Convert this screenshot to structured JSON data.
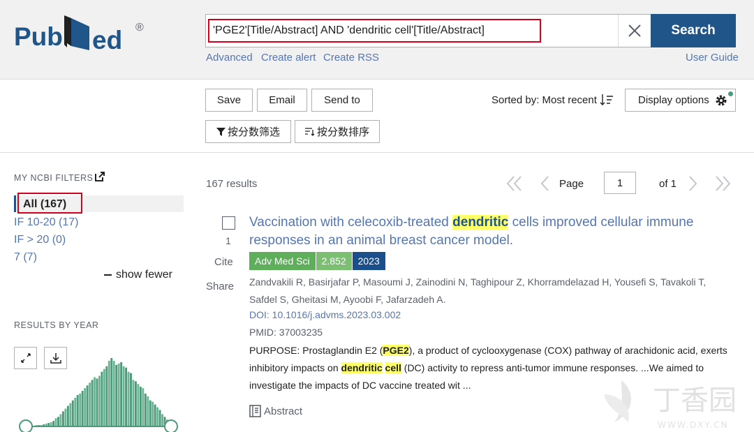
{
  "header": {
    "logo_text_left": "Pub",
    "logo_text_right": "ed",
    "logo_reg": "®",
    "search_value": "'PGE2'[Title/Abstract] AND 'dendritic cell'[Title/Abstract]",
    "search_button": "Search",
    "links": {
      "advanced": "Advanced",
      "create_alert": "Create alert",
      "create_rss": "Create RSS",
      "user_guide": "User Guide"
    }
  },
  "toolbar": {
    "save": "Save",
    "email": "Email",
    "send_to": "Send to",
    "filter_by_score": "按分数筛选",
    "sort_by_score": "按分数排序",
    "sorted_by": "Sorted by: Most recent",
    "display_options": "Display options"
  },
  "sidebar": {
    "ncbi_filters_title": "MY NCBI FILTERS",
    "filters": [
      {
        "label": "All (167)",
        "active": true
      },
      {
        "label": "IF 10-20 (17)",
        "active": false
      },
      {
        "label": "IF > 20 (0)",
        "active": false
      },
      {
        "label": "7 (7)",
        "active": false
      }
    ],
    "show_fewer": "show fewer",
    "results_by_year_title": "RESULTS BY YEAR"
  },
  "chart_data": {
    "type": "bar",
    "title": "RESULTS BY YEAR",
    "values": [
      1,
      1,
      1,
      1,
      2,
      2,
      2,
      3,
      4,
      5,
      6,
      8,
      12,
      14,
      18,
      22,
      26,
      30,
      34,
      38,
      42,
      46,
      48,
      52,
      56,
      60,
      64,
      68,
      72,
      70,
      74,
      80,
      84,
      88,
      96,
      100,
      96,
      90,
      92,
      94,
      88,
      86,
      80,
      78,
      68,
      66,
      62,
      58,
      56,
      48,
      44,
      38,
      36,
      32,
      28,
      24,
      18,
      14,
      10,
      8
    ],
    "color": "#4c9a7a"
  },
  "results": {
    "count": "167 results",
    "pagination": {
      "page_label": "Page",
      "page": "1",
      "of": "of 1"
    },
    "items": [
      {
        "num": "1",
        "cite": "Cite",
        "share": "Share",
        "title_before": "Vaccination with celecoxib-treated ",
        "title_hl": "dendritic",
        "title_after": " cells improved cellular immune responses in an animal breast cancer model.",
        "journal": "Adv Med Sci",
        "impact_factor": "2.852",
        "year": "2023",
        "authors": "Zandvakili R, Basirjafar P, Masoumi J, Zainodini N, Taghipour Z, Khorramdelazad H, Yousefi S, Tavakoli T, Safdel S, Gheitasi M, Ayoobi F, Jafarzadeh A.",
        "doi": "DOI: 10.1016/j.advms.2023.03.002",
        "pmid": "PMID: 37003235",
        "abstract_1": "PURPOSE: Prostaglandin E2 (",
        "abstract_hl1": "PGE2",
        "abstract_2": "), a product of cyclooxygenase (COX) pathway of arachidonic acid, exerts inhibitory impacts on ",
        "abstract_hl2": "dendritic",
        "abstract_3": " ",
        "abstract_hl3": "cell",
        "abstract_4": " (DC) activity to repress anti-tumor immune responses. ...We aimed to investigate the impacts of DC vaccine treated wit ...",
        "abstract_link": "Abstract"
      }
    ]
  },
  "watermark": {
    "text": "丁香园",
    "sub": "WWW.DXY.CN"
  },
  "colors": {
    "accent": "#20558a",
    "link": "#5676b0",
    "highlight": "#ffff66",
    "annotation": "#d0021b"
  }
}
